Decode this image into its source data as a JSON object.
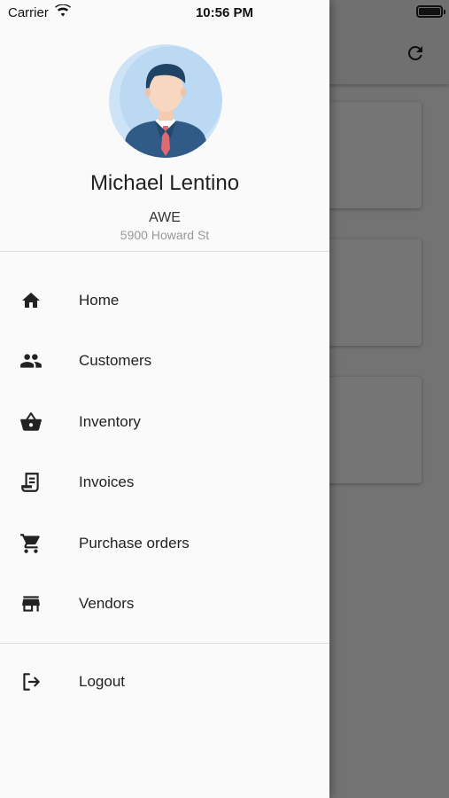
{
  "status_bar": {
    "carrier": "Carrier",
    "time": "10:56 PM"
  },
  "profile": {
    "name": "Michael Lentino",
    "company": "AWE",
    "address": "5900 Howard St"
  },
  "nav": {
    "items": [
      {
        "label": "Home",
        "icon": "home-icon"
      },
      {
        "label": "Customers",
        "icon": "people-icon"
      },
      {
        "label": "Inventory",
        "icon": "basket-icon"
      },
      {
        "label": "Invoices",
        "icon": "receipt-icon"
      },
      {
        "label": "Purchase orders",
        "icon": "cart-icon"
      },
      {
        "label": "Vendors",
        "icon": "store-icon"
      }
    ],
    "logout": {
      "label": "Logout",
      "icon": "logout-icon"
    }
  },
  "colors": {
    "drawer_bg": "#fafafa",
    "scrim": "rgba(0,0,0,0.54)",
    "avatar_bg": "#cfe3f7"
  }
}
